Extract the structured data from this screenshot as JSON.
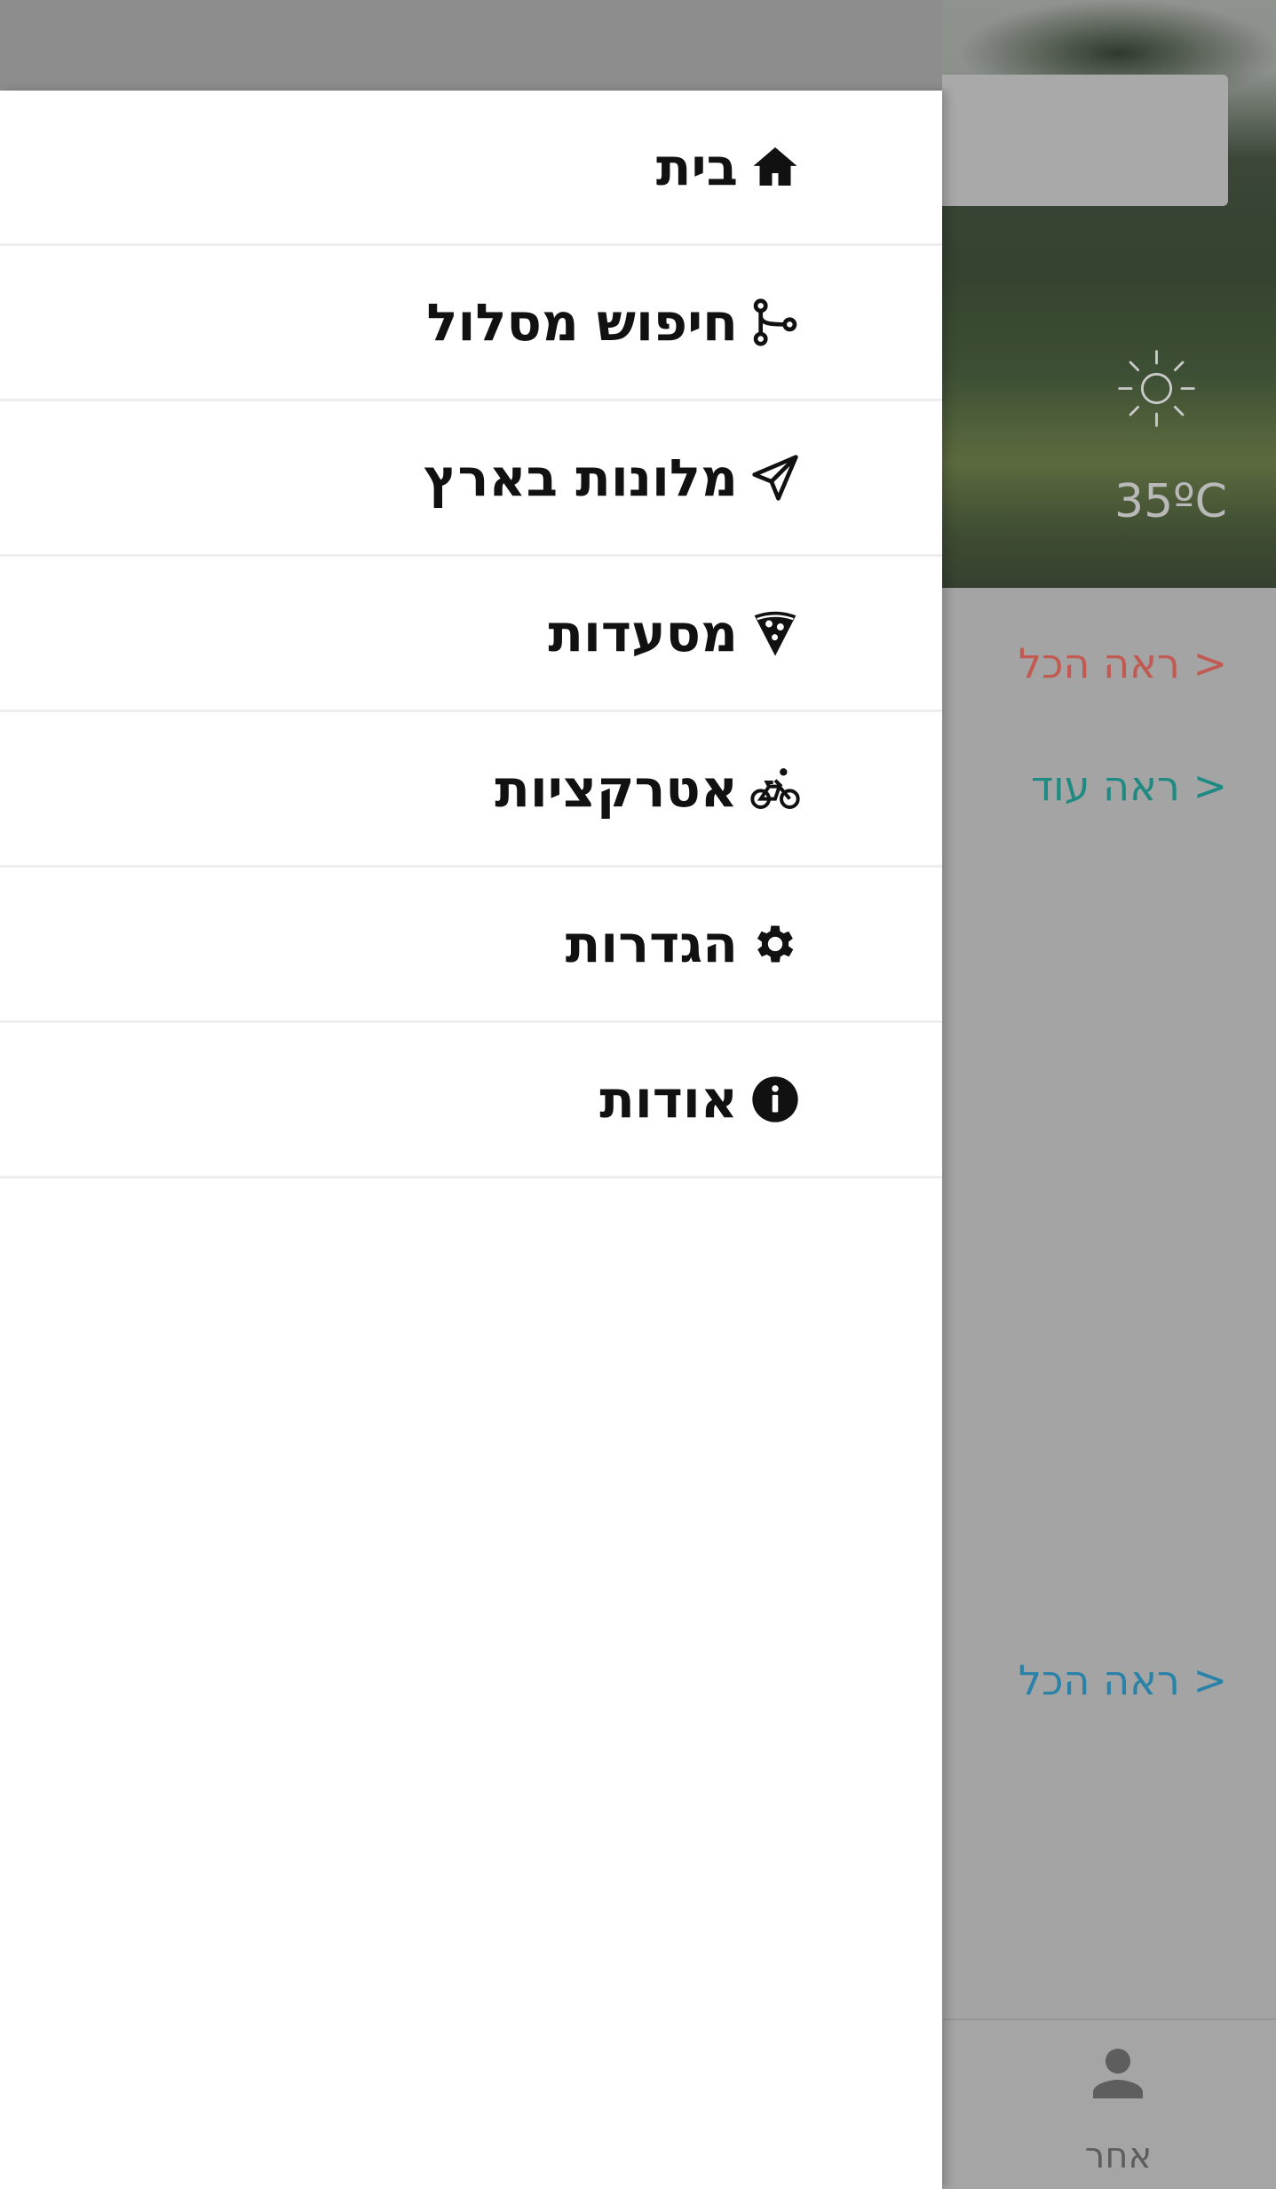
{
  "background": {
    "weather": {
      "icon": "sun-icon",
      "temperature": "35ºC"
    },
    "links": [
      {
        "label": "< ראה הכל",
        "color": "#c25a52"
      },
      {
        "label": "< ראה עוד",
        "color": "#1e8a82"
      },
      {
        "label": "< ראה הכל",
        "color": "#2a82a8"
      }
    ],
    "bottom_nav": {
      "icon": "person-icon",
      "label": "אחר"
    }
  },
  "drawer": {
    "items": [
      {
        "label": "בית",
        "icon": "home-icon"
      },
      {
        "label": "חיפוש מסלול",
        "icon": "route-icon"
      },
      {
        "label": "מלונות בארץ",
        "icon": "paper-plane-icon"
      },
      {
        "label": "מסעדות",
        "icon": "pizza-icon"
      },
      {
        "label": "אטרקציות",
        "icon": "bicycle-icon"
      },
      {
        "label": "הגדרות",
        "icon": "gear-icon"
      },
      {
        "label": "אודות",
        "icon": "info-icon"
      }
    ]
  }
}
